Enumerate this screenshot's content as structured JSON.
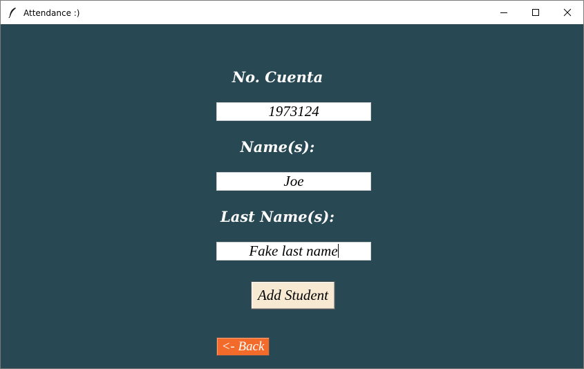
{
  "window": {
    "title": "Attendance :)",
    "app_icon": "tk-feather-icon",
    "controls": [
      "minimize-icon",
      "maximize-icon",
      "close-icon"
    ]
  },
  "form": {
    "account_label": "No. Cuenta",
    "account_value": "1973124",
    "name_label": "Name(s):",
    "name_value": "Joe",
    "last_name_label": "Last Name(s):",
    "last_name_value": "Fake last name",
    "add_button": "Add Student",
    "back_button": "<- Back"
  },
  "colors": {
    "background": "#284853",
    "add_button_bg": "#f8e9d2",
    "back_button_bg": "#f26b2a"
  }
}
